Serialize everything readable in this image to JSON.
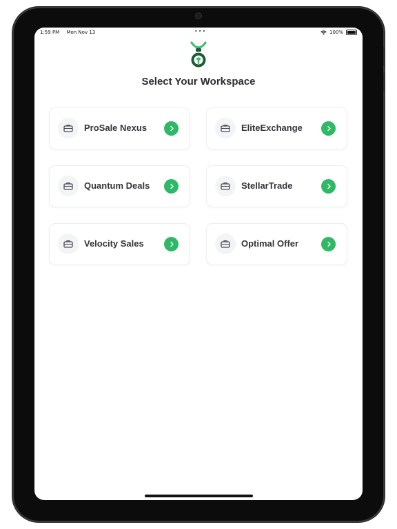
{
  "status_bar": {
    "time": "1:59 PM",
    "date": "Mon Nov 13",
    "multitask_dots": "•••",
    "battery": "100%",
    "wifi_icon": "wifi-icon",
    "battery_icon": "battery-icon"
  },
  "header": {
    "logo_icon": "app-logo-icon",
    "title": "Select Your Workspace"
  },
  "workspaces": [
    {
      "label": "ProSale Nexus",
      "icon": "briefcase-icon",
      "action_icon": "chevron-right-icon"
    },
    {
      "label": "EliteExchange",
      "icon": "briefcase-icon",
      "action_icon": "chevron-right-icon"
    },
    {
      "label": "Quantum Deals",
      "icon": "briefcase-icon",
      "action_icon": "chevron-right-icon"
    },
    {
      "label": "StellarTrade",
      "icon": "briefcase-icon",
      "action_icon": "chevron-right-icon"
    },
    {
      "label": "Velocity Sales",
      "icon": "briefcase-icon",
      "action_icon": "chevron-right-icon"
    },
    {
      "label": "Optimal Offer",
      "icon": "briefcase-icon",
      "action_icon": "chevron-right-icon"
    }
  ],
  "colors": {
    "accent": "#2fb866",
    "logo_dark": "#1d5a35",
    "logo_light": "#35c06e",
    "title_text": "#2b2b33"
  }
}
